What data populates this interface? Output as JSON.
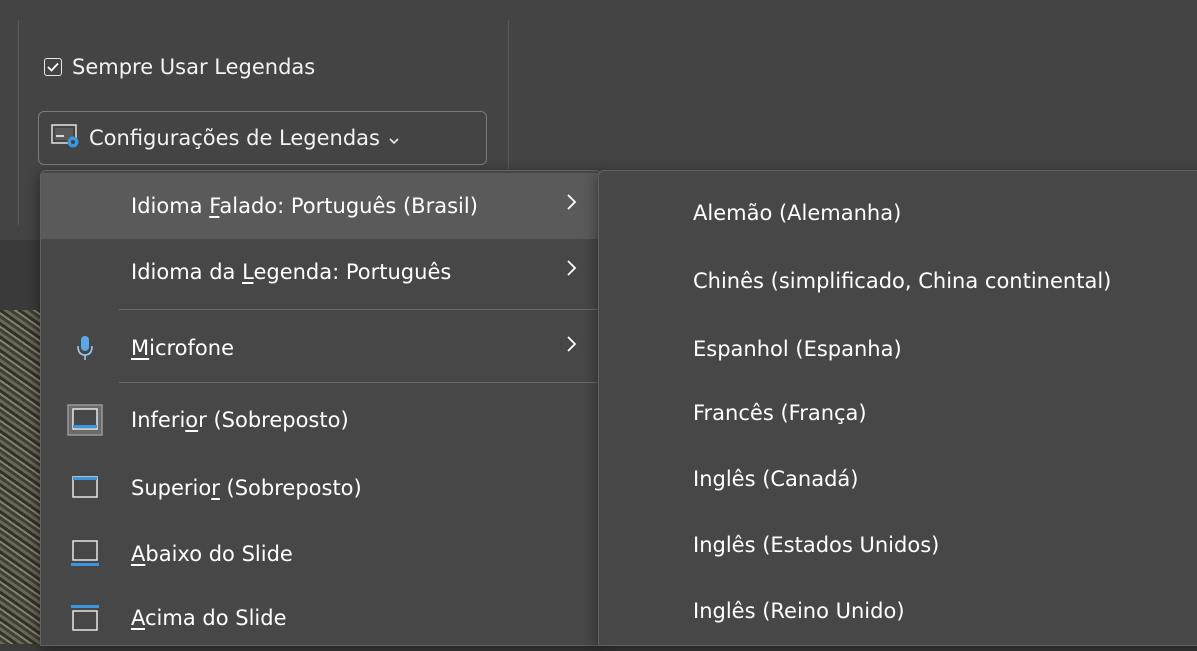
{
  "ribbon": {
    "always_use_captions": {
      "label": "Sempre Usar Legendas",
      "checked": true
    },
    "caption_settings_button": {
      "label": "Configurações de Legendas",
      "icon": "caption-settings-icon"
    }
  },
  "menu": {
    "items": [
      {
        "pre": "Idioma ",
        "key": "F",
        "post": "alado: Português (Brasil)",
        "icon": "",
        "has_submenu": true,
        "highlighted": true
      },
      {
        "pre": "Idioma da ",
        "key": "L",
        "post": "egenda: Português",
        "icon": "",
        "has_submenu": true,
        "highlighted": false
      },
      {
        "pre": "",
        "key": "M",
        "post": "icrofone",
        "icon": "microphone-icon",
        "has_submenu": true,
        "highlighted": false
      },
      {
        "pre": "Inferi",
        "key": "o",
        "post": "r (Sobreposto)",
        "icon": "caption-bottom-overlay-icon",
        "has_submenu": false,
        "highlighted": false
      },
      {
        "pre": "Superio",
        "key": "r",
        "post": " (Sobreposto)",
        "icon": "caption-top-overlay-icon",
        "has_submenu": false,
        "highlighted": false
      },
      {
        "pre": "",
        "key": "A",
        "post": "baixo do Slide",
        "icon": "caption-below-slide-icon",
        "has_submenu": false,
        "highlighted": false
      },
      {
        "pre": "",
        "key": "A",
        "post": "cima do Slide",
        "icon": "caption-above-slide-icon",
        "has_submenu": false,
        "highlighted": false
      }
    ]
  },
  "submenu": {
    "items": [
      "Alemão (Alemanha)",
      "Chinês (simplificado, China continental)",
      "Espanhol (Espanha)",
      "Francês (França)",
      "Inglês (Canadá)",
      "Inglês (Estados Unidos)",
      "Inglês (Reino Unido)"
    ]
  },
  "colors": {
    "accent": "#3a96dd",
    "menu_bg": "#474747",
    "highlight": "#5a5a5a"
  }
}
